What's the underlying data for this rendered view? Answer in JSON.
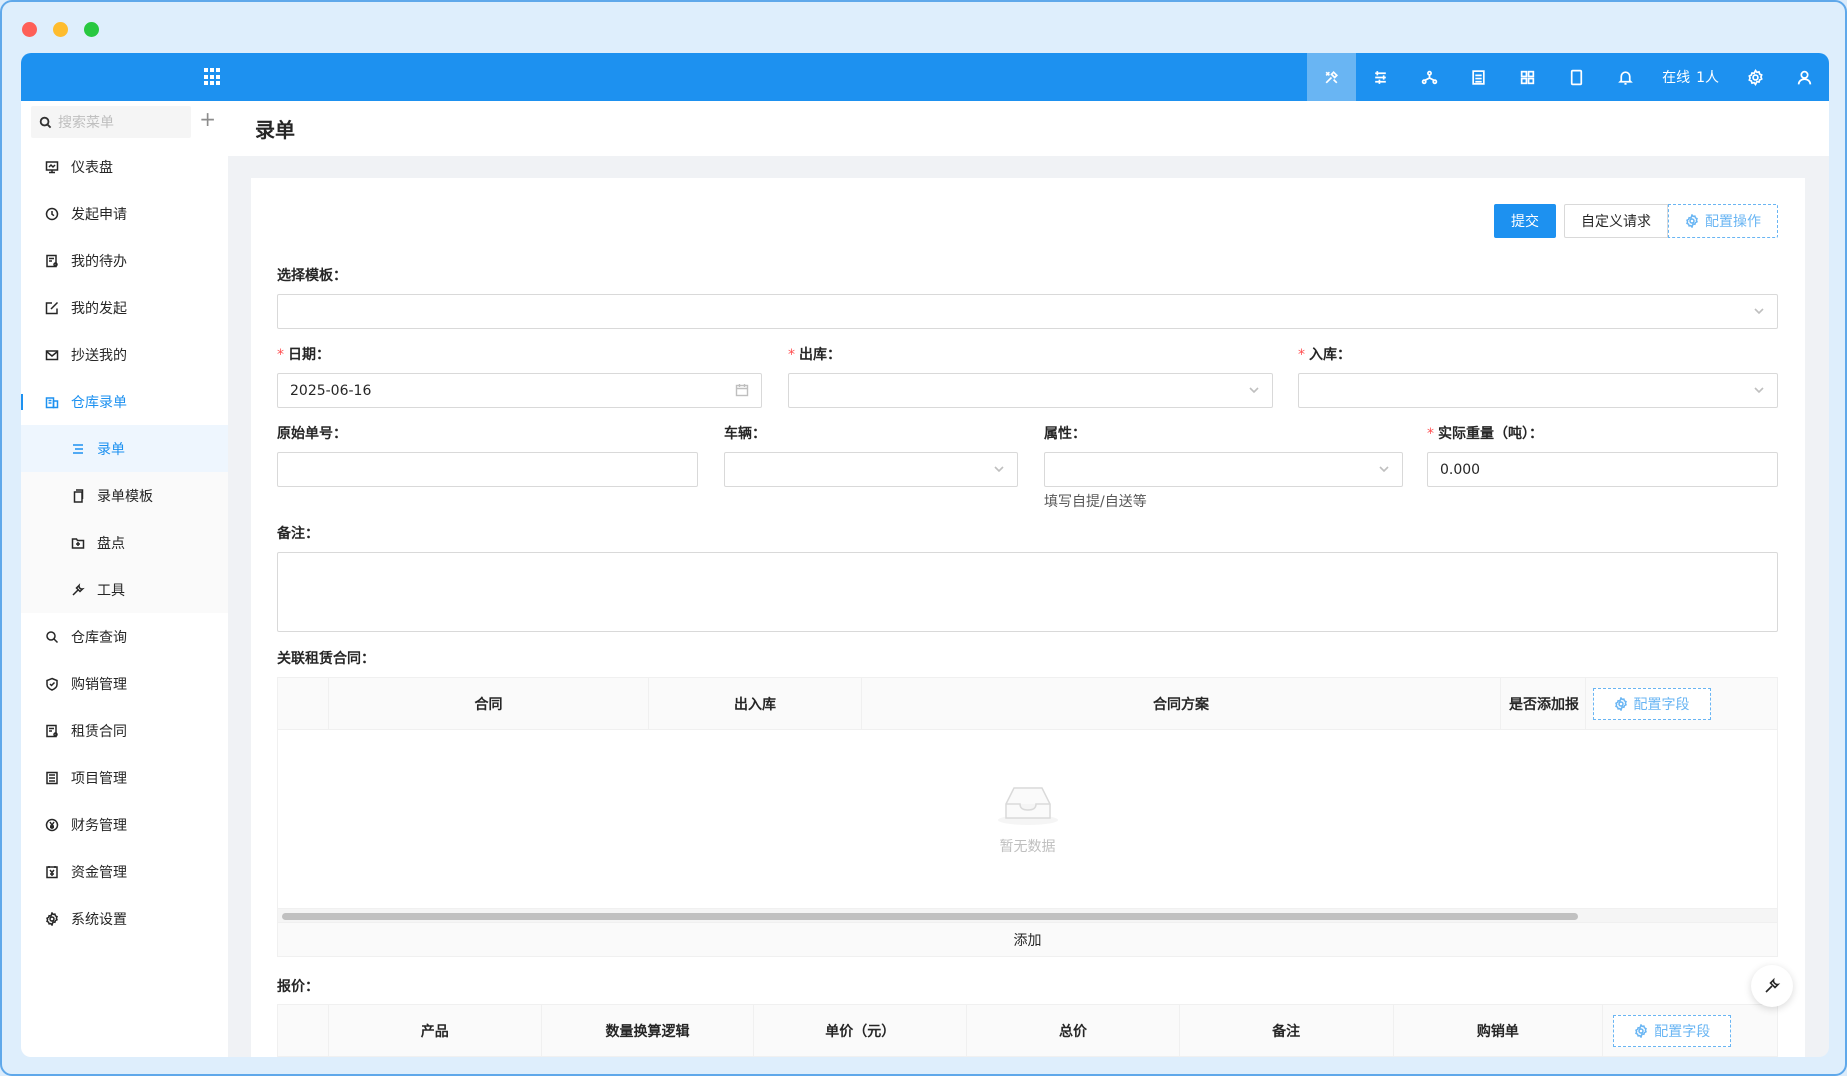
{
  "topbar": {
    "online_label": "在线",
    "online_count": "1人",
    "icons": [
      "tools-icon",
      "stack-icon",
      "network-icon",
      "document-icon",
      "grid-icon",
      "tablet-icon",
      "bell-icon",
      "gear-icon",
      "user-icon"
    ]
  },
  "sidebar": {
    "search_placeholder": "搜索菜单",
    "items": [
      {
        "label": "仪表盘",
        "icon": "dashboard-icon"
      },
      {
        "label": "发起申请",
        "icon": "clock-icon"
      },
      {
        "label": "我的待办",
        "icon": "todo-icon"
      },
      {
        "label": "我的发起",
        "icon": "edit-icon"
      },
      {
        "label": "抄送我的",
        "icon": "mail-icon"
      },
      {
        "label": "仓库录单",
        "icon": "warehouse-icon"
      }
    ],
    "sub_items": [
      {
        "label": "录单",
        "icon": "list-icon"
      },
      {
        "label": "录单模板",
        "icon": "copy-icon"
      },
      {
        "label": "盘点",
        "icon": "folder-icon"
      },
      {
        "label": "工具",
        "icon": "wrench-icon"
      }
    ],
    "items_after": [
      {
        "label": "仓库查询",
        "icon": "search-icon"
      },
      {
        "label": "购销管理",
        "icon": "shield-icon"
      },
      {
        "label": "租赁合同",
        "icon": "contract-icon"
      },
      {
        "label": "项目管理",
        "icon": "project-icon"
      },
      {
        "label": "财务管理",
        "icon": "yen-icon"
      },
      {
        "label": "资金管理",
        "icon": "fund-icon"
      },
      {
        "label": "系统设置",
        "icon": "gear-icon"
      }
    ]
  },
  "page": {
    "title": "录单",
    "submit_label": "提交",
    "custom_request_label": "自定义请求",
    "config_action_label": "配置操作"
  },
  "form": {
    "template_label": "选择模板",
    "date_label": "日期",
    "date_value": "2025-06-16",
    "outbound_label": "出库",
    "inbound_label": "入库",
    "orig_no_label": "原始单号",
    "vehicle_label": "车辆",
    "attr_label": "属性",
    "attr_help": "填写自提/自送等",
    "weight_label": "实际重量（吨）",
    "weight_value": "0.000",
    "remark_label": "备注",
    "colon": "："
  },
  "contract_table": {
    "label": "关联租赁合同",
    "columns": [
      "合同",
      "出入库",
      "合同方案",
      "是否添加报"
    ],
    "config_label": "配置字段",
    "empty_text": "暂无数据",
    "add_label": "添加"
  },
  "quote_table": {
    "label": "报价",
    "columns": [
      "产品",
      "数量换算逻辑",
      "单价（元）",
      "总价",
      "备注",
      "购销单"
    ],
    "config_label": "配置字段"
  }
}
